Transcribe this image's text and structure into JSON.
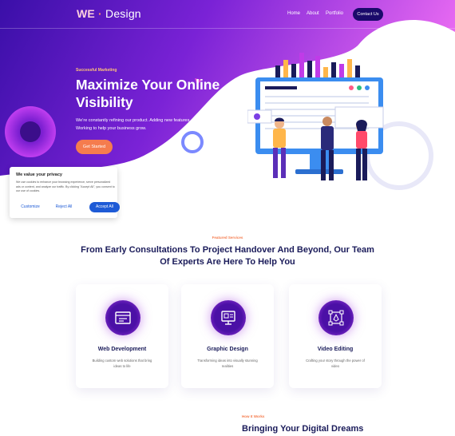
{
  "brand": {
    "we": "WE",
    "dot": "·",
    "design": "Design"
  },
  "nav": {
    "home": "Home",
    "about": "About",
    "portfolio": "Portfolio",
    "contact": "Contact Us"
  },
  "hero": {
    "eyebrow": "Successful Marketing",
    "title": "Maximize Your Online Visibility",
    "subtitle": "We’re constantly refining our product. Adding new features. Working to help your business grow.",
    "cta": "Get Started"
  },
  "privacy": {
    "title": "We value your privacy",
    "body": "We use cookies to enhance your browsing experience, serve personalized ads or content, and analyze our traffic. By clicking \"Accept All\", you consent to our use of cookies.",
    "customize": "Customize",
    "reject": "Reject All",
    "accept": "Accept All"
  },
  "services": {
    "eyebrow": "Featured Services",
    "title": "From Early Consultations To Project Handover And Beyond, Our Team Of Experts Are Here To Help You",
    "cards": [
      {
        "title": "Web Development",
        "desc": "Building custom web solutions that bring ideas to life",
        "icon": "browser-code-icon"
      },
      {
        "title": "Graphic Design",
        "desc": "Transforming ideas into visually stunning realities",
        "icon": "design-monitor-icon"
      },
      {
        "title": "Video Editing",
        "desc": "Crafting your story through the power of video",
        "icon": "vector-pen-icon"
      }
    ]
  },
  "how": {
    "eyebrow": "How It Works",
    "title": "Bringing Your Digital Dreams"
  },
  "colors": {
    "accent": "#f57c4e",
    "primary": "#1a1b5a",
    "hero_start": "#3a0fa8",
    "hero_end": "#e05bf0",
    "privacy_button": "#1e5bd6"
  }
}
